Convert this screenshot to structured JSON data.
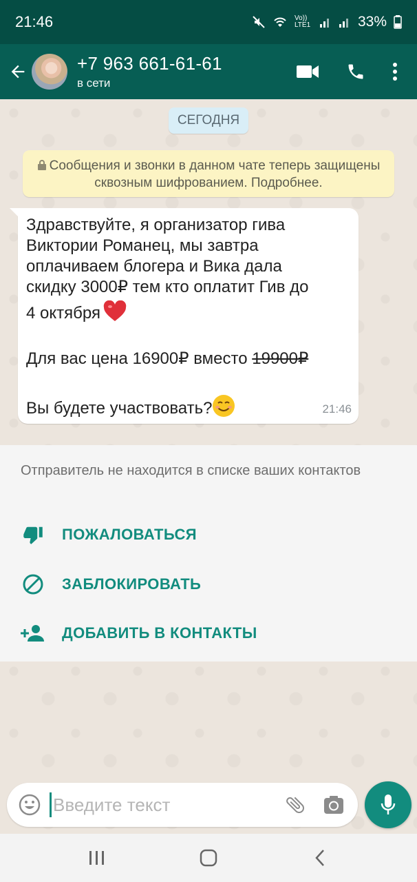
{
  "status_bar": {
    "time": "21:46",
    "battery": "33%",
    "network": "Vo)) LTE1"
  },
  "header": {
    "name": "+7 963 661-61-61",
    "status": "в сети"
  },
  "chat": {
    "date_label": "СЕГОДНЯ",
    "encryption_notice": "Сообщения и звонки в данном чате теперь защищены сквозным шифрованием. Подробнее.",
    "message": {
      "lines": [
        "Здравствуйте, я организатор гива",
        "Виктории Романец, мы завтра",
        "оплачиваем блогера и Вика дала",
        "скидку 3000₽ тем кто оплатит Гив до",
        "4 октября"
      ],
      "price_text": "Для вас цена 16900₽ вместо ",
      "old_price": "19900₽",
      "question": "Вы будете участвовать?",
      "time": "21:46"
    }
  },
  "unknown_contact": {
    "notice": "Отправитель не находится в списке ваших контактов",
    "report_label": "ПОЖАЛОВАТЬСЯ",
    "block_label": "ЗАБЛОКИРОВАТЬ",
    "add_label": "ДОБАВИТЬ В КОНТАКТЫ"
  },
  "input": {
    "placeholder": "Введите текст"
  },
  "colors": {
    "header": "#075e54",
    "status_bar": "#054d44",
    "accent": "#128c7e",
    "chat_bg": "#ece5dd"
  },
  "icons": [
    "back-arrow-icon",
    "video-call-icon",
    "phone-icon",
    "more-vert-icon",
    "lock-icon",
    "heart-emoji",
    "smile-emoji",
    "thumb-down-icon",
    "block-icon",
    "add-contact-icon",
    "emoji-icon",
    "attach-icon",
    "camera-icon",
    "mic-icon"
  ]
}
